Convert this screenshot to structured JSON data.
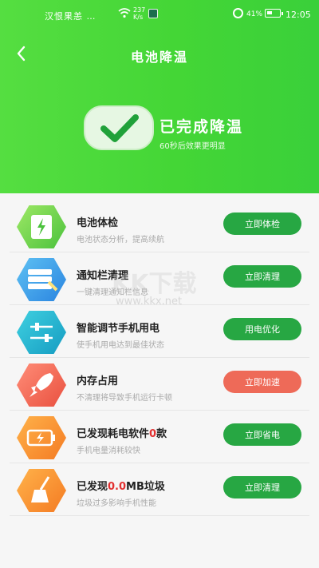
{
  "status_bar": {
    "carrier": "汉恨果恙 …",
    "speed": "237\nK/s",
    "signal": "41%",
    "time": "12:05"
  },
  "header": {
    "title": "电池降温",
    "back_icon": "chevron-left-icon"
  },
  "hero": {
    "status_title": "已完成降温",
    "status_subtitle": "60秒后效果更明显"
  },
  "items": [
    {
      "title": "电池体检",
      "desc": "电池状态分析，提高续航",
      "button": "立即体检",
      "icon": "battery-lightning-icon",
      "button_color": "#27a743"
    },
    {
      "title": "通知栏清理",
      "desc": "一键清理通知栏信息",
      "button": "立即清理",
      "icon": "notification-clean-icon",
      "button_color": "#27a743"
    },
    {
      "title": "智能调节手机用电",
      "desc": "使手机用电达到最佳状态",
      "button": "用电优化",
      "icon": "sliders-icon",
      "button_color": "#27a743"
    },
    {
      "title": "内存占用",
      "desc": "不清理将导致手机运行卡顿",
      "button": "立即加速",
      "icon": "rocket-icon",
      "button_color": "#ee6a58"
    },
    {
      "title_prefix": "已发现耗电软件",
      "title_count": "0",
      "title_suffix": "款",
      "desc": "手机电量消耗较快",
      "button": "立即省电",
      "icon": "battery-charging-icon",
      "button_color": "#27a743"
    },
    {
      "title_prefix": "已发现",
      "title_count": "0.0",
      "title_suffix": "MB垃圾",
      "desc": "垃圾过多影响手机性能",
      "button": "立即清理",
      "icon": "broom-icon",
      "button_color": "#27a743"
    }
  ],
  "watermark": {
    "main": "KK下载",
    "url": "www.kkx.net"
  },
  "colors": {
    "hero_green": "#44d636",
    "button_green": "#27a743",
    "button_red": "#ee6a58"
  }
}
